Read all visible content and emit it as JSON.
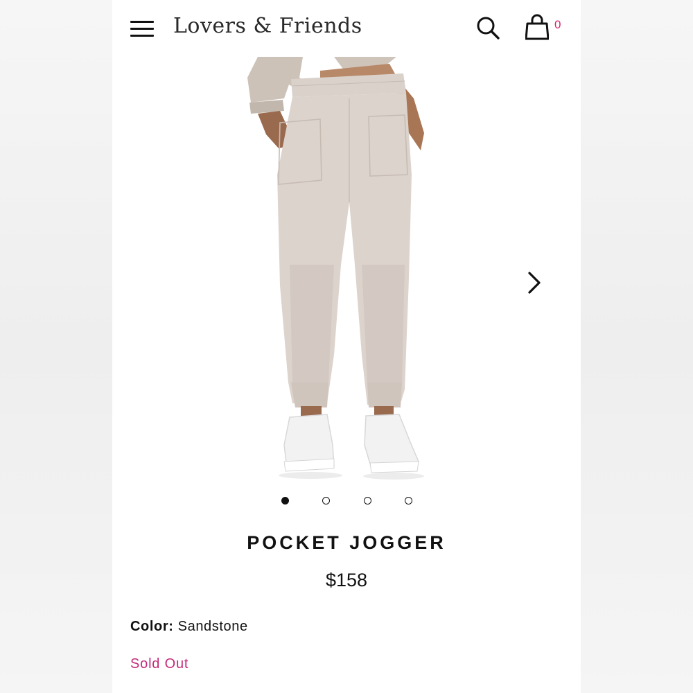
{
  "header": {
    "brand": "Lovers & Friends",
    "cart_count": "0",
    "accent_color": "#d6276f"
  },
  "icons": {
    "menu": "hamburger-menu-icon",
    "search": "search-icon",
    "cart": "shopping-bag-icon",
    "next": "chevron-right-icon"
  },
  "gallery": {
    "total_images": 4,
    "active_index": 0
  },
  "product": {
    "name": "POCKET JOGGER",
    "price": "$158",
    "color_label": "Color:",
    "color_value": "Sandstone",
    "availability": "Sold Out",
    "availability_color": "#c42a7a"
  }
}
